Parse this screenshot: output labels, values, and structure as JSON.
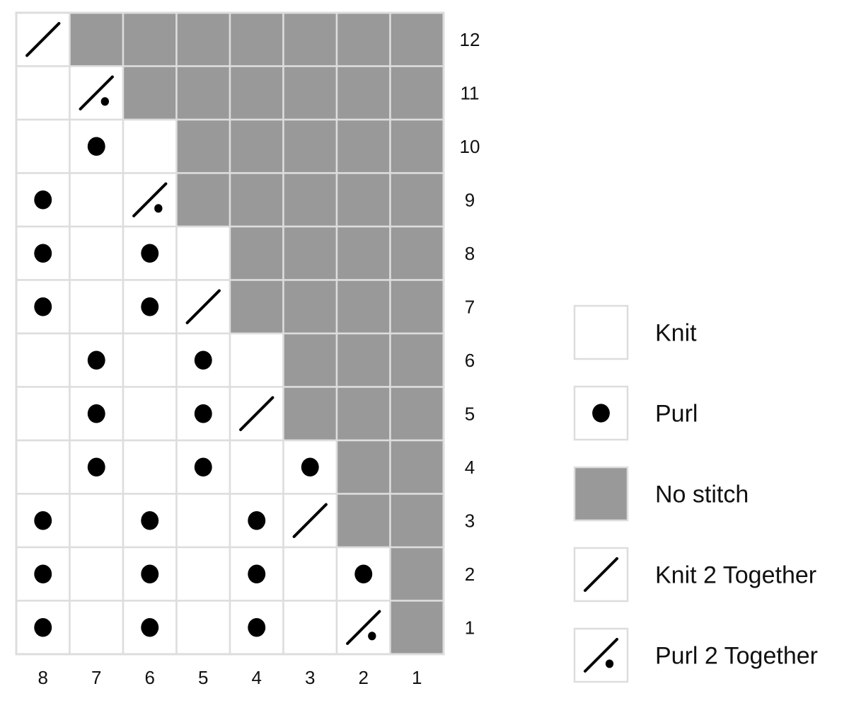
{
  "chart_data": {
    "type": "heatmap",
    "title": "",
    "description": "Knitting chart, 8 stitches wide by 12 rows; rows read from bottom (1) to top (12), columns numbered right (1) to left (8).",
    "columns": [
      "8",
      "7",
      "6",
      "5",
      "4",
      "3",
      "2",
      "1"
    ],
    "rows": [
      "12",
      "11",
      "10",
      "9",
      "8",
      "7",
      "6",
      "5",
      "4",
      "3",
      "2",
      "1"
    ],
    "symbol_key": {
      "K": "Knit",
      "P": "Purl",
      "N": "No stitch",
      "K2": "Knit 2 Together",
      "P2": "Purl 2 Together"
    },
    "grid": [
      [
        "K2",
        "N",
        "N",
        "N",
        "N",
        "N",
        "N",
        "N"
      ],
      [
        "K",
        "P2",
        "N",
        "N",
        "N",
        "N",
        "N",
        "N"
      ],
      [
        "K",
        "P",
        "K",
        "N",
        "N",
        "N",
        "N",
        "N"
      ],
      [
        "P",
        "K",
        "P2",
        "N",
        "N",
        "N",
        "N",
        "N"
      ],
      [
        "P",
        "K",
        "P",
        "K",
        "N",
        "N",
        "N",
        "N"
      ],
      [
        "P",
        "K",
        "P",
        "K2",
        "N",
        "N",
        "N",
        "N"
      ],
      [
        "K",
        "P",
        "K",
        "P",
        "K",
        "N",
        "N",
        "N"
      ],
      [
        "K",
        "P",
        "K",
        "P",
        "K2",
        "N",
        "N",
        "N"
      ],
      [
        "K",
        "P",
        "K",
        "P",
        "K",
        "P",
        "N",
        "N"
      ],
      [
        "P",
        "K",
        "P",
        "K",
        "P",
        "K2",
        "N",
        "N"
      ],
      [
        "P",
        "K",
        "P",
        "K",
        "P",
        "K",
        "P",
        "N"
      ],
      [
        "P",
        "K",
        "P",
        "K",
        "P",
        "K",
        "P2",
        "N"
      ]
    ],
    "legend": [
      {
        "symbol": "K",
        "label": "Knit"
      },
      {
        "symbol": "P",
        "label": "Purl"
      },
      {
        "symbol": "N",
        "label": "No stitch"
      },
      {
        "symbol": "K2",
        "label": "Knit 2 Together"
      },
      {
        "symbol": "P2",
        "label": "Purl 2 Together"
      }
    ],
    "legend_position": "right",
    "colors": {
      "stitch": "#ffffff",
      "no_stitch": "#999999",
      "grid_line": "#dddddd",
      "symbol": "#000000"
    }
  }
}
